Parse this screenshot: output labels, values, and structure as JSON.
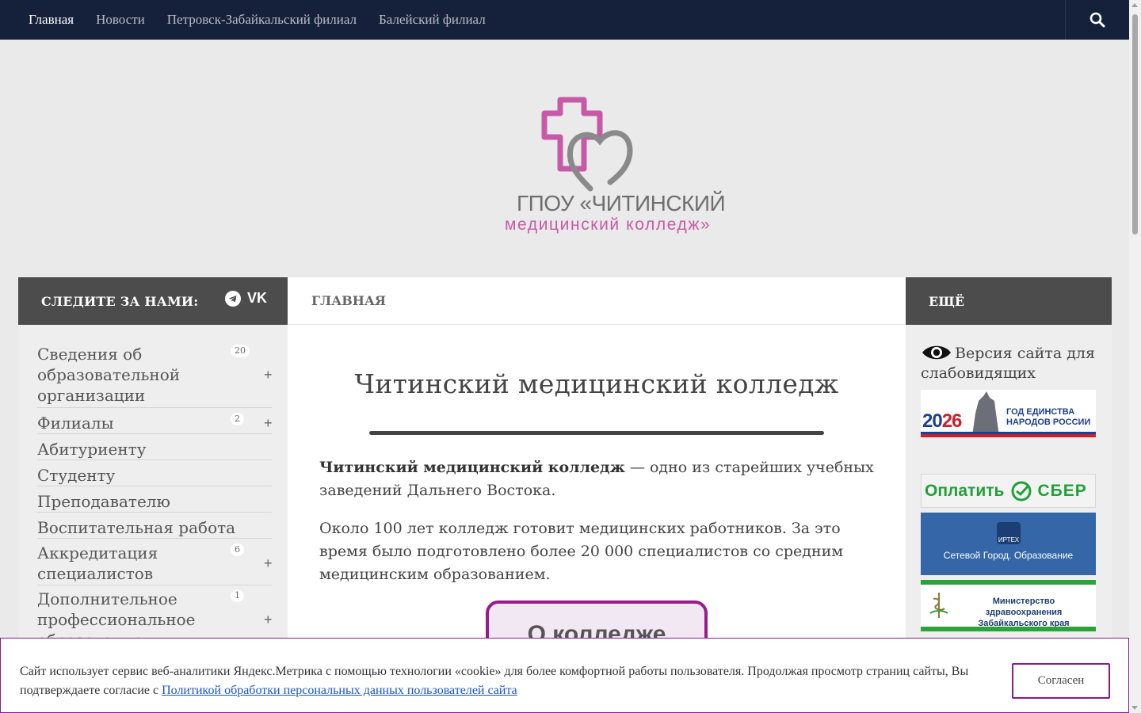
{
  "nav": {
    "items": [
      "Главная",
      "Новости",
      "Петровск-Забайкальский филиал",
      "Балейский филиал"
    ],
    "search_icon": "search-icon"
  },
  "logo": {
    "line1": "ГПОУ «ЧИТИНСКИЙ",
    "line2": "медицинский колледж»",
    "colors": {
      "pink": "#c65aa6",
      "gray": "#6e6e6e"
    }
  },
  "left": {
    "header": "СЛЕДИТЕ ЗА НАМИ:",
    "social": [
      "telegram-icon",
      "vk-icon"
    ],
    "vk_label": "VK",
    "menu": [
      {
        "label": "Сведения об образовательной организации",
        "badge": "20"
      },
      {
        "label": "Филиалы",
        "badge": "2"
      },
      {
        "label": "Абитуриенту"
      },
      {
        "label": "Студенту"
      },
      {
        "label": "Преподавателю"
      },
      {
        "label": "Воспитательная работа"
      },
      {
        "label": "Аккредитация специалистов",
        "badge": "6"
      },
      {
        "label": "Дополнительное профессиональное образование",
        "badge": "1"
      }
    ],
    "plus": "+"
  },
  "main": {
    "header": "ГЛАВНАЯ",
    "title": "Читинский медицинский колледж",
    "p1_bold": "Читинский медицинский колледж",
    "p1_rest": " — одно из старейших учебных заведений Дальнего Востока.",
    "p2": "Около 100 лет колледж готовит медицинских работников. За это время было подготовлено более 20 000 специалистов со средним медицинским образованием.",
    "about_button": "О колледже"
  },
  "right": {
    "header": "ЕЩЁ",
    "vision": "Версия сайта для слабовидящих",
    "banner2026": {
      "year_a": "20",
      "year_b": "26",
      "text": "ГОД ЕДИНСТВА НАРОДОВ РОССИИ"
    },
    "sber": {
      "pay": "Оплатить",
      "brand": "СБЕР"
    },
    "net": {
      "logo": "ИРТЕХ",
      "text": "Сетевой Город. Образование"
    },
    "ministry": "Министерство здравоохранения Забайкальского края"
  },
  "cookie": {
    "text": "Сайт использует сервис веб-аналитики Яндекс.Метрика с помощью технологии «cookie» для более комфортной работы пользователя. Продолжая просмотр страниц сайты, Вы подтверждаете согласие с ",
    "link": "Политикой обработки персональных данных пользователей сайта",
    "button": "Согласен"
  },
  "colors": {
    "nav_bg": "#15203a",
    "panel_dark": "#4c4c4c",
    "accent": "#8b1a86",
    "link": "#1a55c9"
  }
}
